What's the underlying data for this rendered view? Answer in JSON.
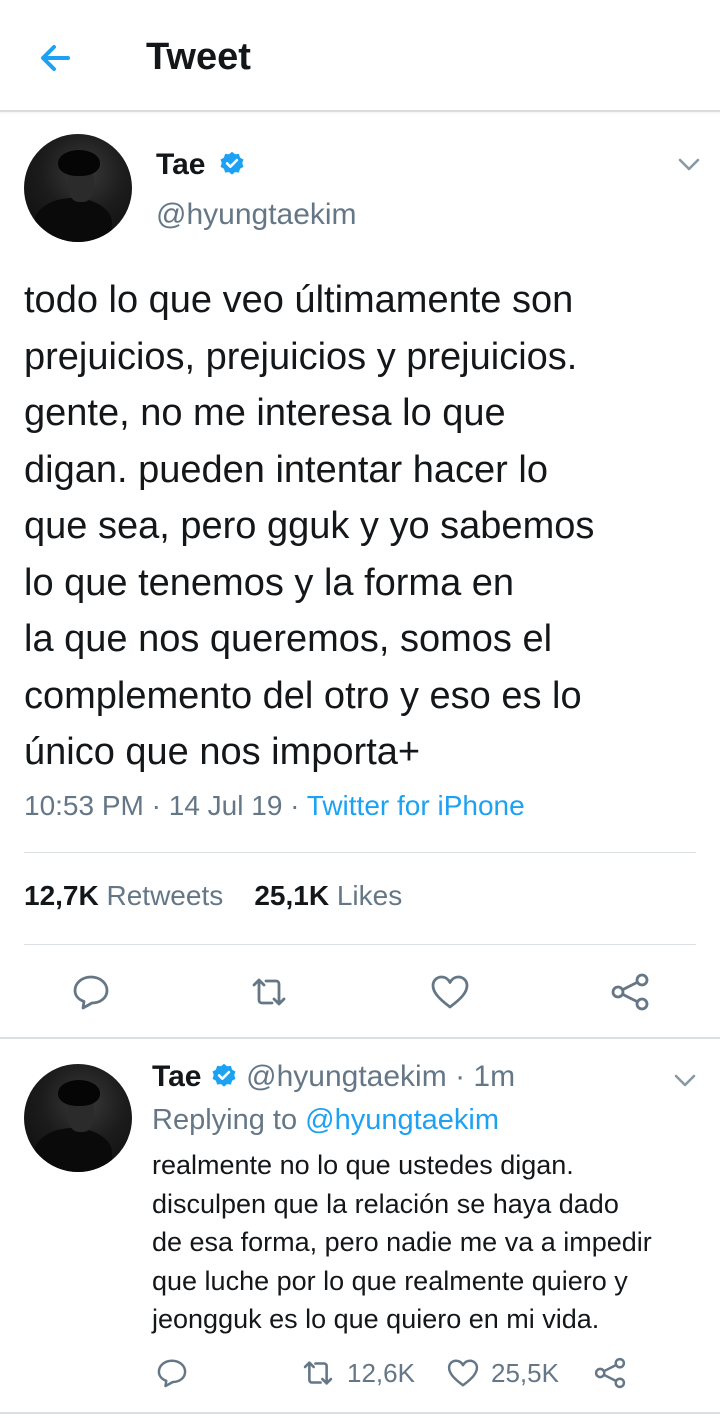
{
  "header": {
    "title": "Tweet",
    "back_icon": "arrow-left-icon",
    "accent": "#1da1f2"
  },
  "tweet": {
    "name": "Tae",
    "handle": "@hyungtaekim",
    "text_lines": [
      "todo lo que veo últimamente son",
      "prejuicios, prejuicios y prejuicios.",
      "gente, no me interesa lo que",
      "digan. pueden intentar hacer lo",
      "que sea, pero gguk y yo sabemos",
      "lo que tenemos y la forma en",
      "la que nos queremos, somos el",
      "complemento del otro y eso es lo",
      "único que nos importa+"
    ],
    "time": "10:53 PM",
    "date": "14 Jul 19",
    "separator": "·",
    "source": "Twitter for iPhone",
    "retweets_count": "12,7K",
    "retweets_label": "Retweets",
    "likes_count": "25,1K",
    "likes_label": "Likes"
  },
  "reply": {
    "name": "Tae",
    "handle": "@hyungtaekim",
    "separator": "·",
    "age": "1m",
    "replying_label": "Replying to",
    "replying_to": "@hyungtaekim",
    "text_lines": [
      "realmente no lo que ustedes digan.",
      "disculpen que la relación se haya dado",
      "de esa forma, pero nadie me va a impedir",
      "que luche por lo que realmente quiero y",
      "jeongguk es lo que quiero en mi vida."
    ],
    "retweets": "12,6K",
    "likes": "25,5K"
  },
  "icons": [
    "arrow-left-icon",
    "verified-badge-icon",
    "chevron-down-icon",
    "reply-icon",
    "retweet-icon",
    "like-icon",
    "share-icon"
  ]
}
